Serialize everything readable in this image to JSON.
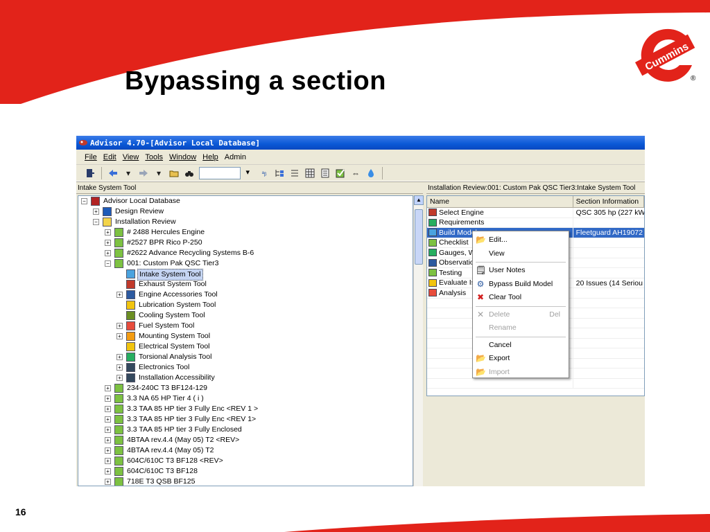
{
  "slide": {
    "title": "Bypassing a section",
    "number": "16",
    "logo_text": "Cummins",
    "logo_mark": "®",
    "accent_color": "#e2231a"
  },
  "window": {
    "title": "Advisor 4.70-[Advisor Local Database]"
  },
  "menu": {
    "file": "File",
    "edit": "Edit",
    "view": "View",
    "tools": "Tools",
    "window": "Window",
    "help": "Help",
    "admin": "Admin"
  },
  "toolbar": {
    "icons": [
      "exit-icon",
      "back-icon",
      "forward-icon",
      "open-folder-icon",
      "find-icon",
      "sort-icon",
      "tree-icon",
      "list-icon",
      "grid-icon",
      "report-icon",
      "checklist-icon",
      "swap-icon",
      "info-icon"
    ]
  },
  "left_pane": {
    "header": "Intake System Tool",
    "tree": [
      {
        "label": "Advisor Local Database",
        "level": 0,
        "expander": "−",
        "icon": "database-icon",
        "icon_color": "#b22222"
      },
      {
        "label": "Design Review",
        "level": 1,
        "expander": "+",
        "icon": "design-review-icon",
        "icon_color": "#1e5bb8"
      },
      {
        "label": "Installation Review",
        "level": 1,
        "expander": "−",
        "icon": "folder-icon",
        "icon_color": "#f3d44a"
      },
      {
        "label": "# 2488 Hercules Engine",
        "level": 2,
        "expander": "+",
        "icon": "installation-icon",
        "icon_color": "#7dc142"
      },
      {
        "label": "#2527 BPR Rico P-250",
        "level": 2,
        "expander": "+",
        "icon": "installation-icon",
        "icon_color": "#7dc142"
      },
      {
        "label": "#2622 Advance Recycling Systems B-6",
        "level": 2,
        "expander": "+",
        "icon": "installation-icon",
        "icon_color": "#7dc142"
      },
      {
        "label": "001: Custom Pak QSC Tier3",
        "level": 2,
        "expander": "−",
        "icon": "installation-icon",
        "icon_color": "#7dc142"
      },
      {
        "label": "Intake System Tool",
        "level": 3,
        "expander": "",
        "icon": "intake-icon",
        "icon_color": "#4aa3df",
        "selected": true
      },
      {
        "label": "Exhaust System Tool",
        "level": 3,
        "expander": "",
        "icon": "exhaust-icon",
        "icon_color": "#c0392b"
      },
      {
        "label": "Engine Accessories Tool",
        "level": 3,
        "expander": "+",
        "icon": "accessories-icon",
        "icon_color": "#2c5aa0"
      },
      {
        "label": "Lubrication System Tool",
        "level": 3,
        "expander": "",
        "icon": "oil-can-icon",
        "icon_color": "#f1c40f"
      },
      {
        "label": "Cooling System Tool",
        "level": 3,
        "expander": "",
        "icon": "cooling-icon",
        "icon_color": "#6b8e23"
      },
      {
        "label": "Fuel System Tool",
        "level": 3,
        "expander": "+",
        "icon": "fuel-icon",
        "icon_color": "#e74c3c"
      },
      {
        "label": "Mounting System Tool",
        "level": 3,
        "expander": "+",
        "icon": "mounting-icon",
        "icon_color": "#f39c12"
      },
      {
        "label": "Electrical System Tool",
        "level": 3,
        "expander": "",
        "icon": "electrical-icon",
        "icon_color": "#f1c40f"
      },
      {
        "label": "Torsional Analysis Tool",
        "level": 3,
        "expander": "+",
        "icon": "torsional-icon",
        "icon_color": "#27ae60"
      },
      {
        "label": "Electronics Tool",
        "level": 3,
        "expander": "+",
        "icon": "electronics-icon",
        "icon_color": "#34495e"
      },
      {
        "label": "Installation Accessibility",
        "level": 3,
        "expander": "+",
        "icon": "accessibility-icon",
        "icon_color": "#34495e"
      },
      {
        "label": "234-240C T3 BF124-129",
        "level": 2,
        "expander": "+",
        "icon": "installation-icon",
        "icon_color": "#7dc142"
      },
      {
        "label": "3.3 NA 65 HP Tier 4 ( i )",
        "level": 2,
        "expander": "+",
        "icon": "installation-icon",
        "icon_color": "#7dc142"
      },
      {
        "label": "3.3 TAA 85 HP tier 3 Fully Enc <REV 1 >",
        "level": 2,
        "expander": "+",
        "icon": "installation-icon",
        "icon_color": "#7dc142"
      },
      {
        "label": "3.3 TAA 85 HP tier 3 Fully Enc <REV 1>",
        "level": 2,
        "expander": "+",
        "icon": "installation-icon",
        "icon_color": "#7dc142"
      },
      {
        "label": "3.3 TAA 85 HP tier 3 Fully Enclosed",
        "level": 2,
        "expander": "+",
        "icon": "installation-icon",
        "icon_color": "#7dc142"
      },
      {
        "label": "4BTAA rev.4.4 (May 05) T2 <REV>",
        "level": 2,
        "expander": "+",
        "icon": "installation-icon",
        "icon_color": "#7dc142"
      },
      {
        "label": "4BTAA rev.4.4 (May 05) T2",
        "level": 2,
        "expander": "+",
        "icon": "installation-icon",
        "icon_color": "#7dc142"
      },
      {
        "label": "604C/610C T3 BF128 <REV>",
        "level": 2,
        "expander": "+",
        "icon": "installation-icon",
        "icon_color": "#7dc142"
      },
      {
        "label": "604C/610C T3 BF128",
        "level": 2,
        "expander": "+",
        "icon": "installation-icon",
        "icon_color": "#7dc142"
      },
      {
        "label": "718E T3 QSB BF125",
        "level": 2,
        "expander": "+",
        "icon": "installation-icon",
        "icon_color": "#7dc142"
      }
    ]
  },
  "right_pane": {
    "header": "Installation Review:001: Custom Pak QSC Tier3:Intake System Tool",
    "columns": [
      "Name",
      "Section Information"
    ],
    "rows": [
      {
        "name": "Select Engine",
        "info": "QSC 305 hp (227 kW",
        "icon": "select-engine-icon",
        "icon_color": "#c0392b"
      },
      {
        "name": "Requirements",
        "info": "",
        "icon": "requirements-icon",
        "icon_color": "#27ae60"
      },
      {
        "name": "Build Model",
        "info": "Fleetguard AH19072",
        "icon": "build-model-icon",
        "icon_color": "#4aa3df",
        "selected": true
      },
      {
        "name": "Checklist",
        "info": "",
        "icon": "checklist-icon",
        "icon_color": "#7dc142"
      },
      {
        "name": "Gauges, Warnings",
        "info": "",
        "icon": "gauges-icon",
        "icon_color": "#27ae60"
      },
      {
        "name": "Observations",
        "info": "",
        "icon": "observations-icon",
        "icon_color": "#2c5aa0"
      },
      {
        "name": "Testing",
        "info": "",
        "icon": "testing-icon",
        "icon_color": "#7dc142"
      },
      {
        "name": "Evaluate Issues",
        "info": "20 Issues (14 Seriou",
        "icon": "evaluate-icon",
        "icon_color": "#f1c40f"
      },
      {
        "name": "Analysis",
        "info": "",
        "icon": "analysis-icon",
        "icon_color": "#e74c3c"
      }
    ]
  },
  "context_menu": {
    "items": [
      {
        "label": "Edit...",
        "icon": "open-folder-icon",
        "glyph": "📂",
        "disabled": false
      },
      {
        "label": "View",
        "icon": "",
        "glyph": "",
        "disabled": false
      },
      {
        "sep": true
      },
      {
        "label": "User Notes",
        "icon": "notes-icon",
        "glyph": "🗒",
        "disabled": false
      },
      {
        "label": "Bypass Build Model",
        "icon": "bypass-icon",
        "glyph": "⚙",
        "disabled": false
      },
      {
        "label": "Clear Tool",
        "icon": "red-x-icon",
        "glyph": "✖",
        "disabled": false
      },
      {
        "sep": true
      },
      {
        "label": "Delete",
        "icon": "delete-icon",
        "glyph": "✕",
        "disabled": true,
        "shortcut": "Del"
      },
      {
        "label": "Rename",
        "icon": "",
        "glyph": "",
        "disabled": true
      },
      {
        "sep": true
      },
      {
        "label": "Cancel",
        "icon": "",
        "glyph": "",
        "disabled": false
      },
      {
        "label": "Export",
        "icon": "export-folder-icon",
        "glyph": "📂",
        "disabled": false
      },
      {
        "label": "Import",
        "icon": "import-folder-icon",
        "glyph": "📂",
        "disabled": true
      }
    ]
  }
}
